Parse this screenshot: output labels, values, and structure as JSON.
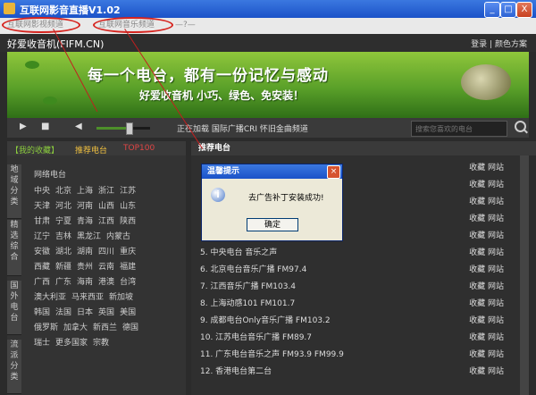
{
  "window": {
    "title": "互联网影音直播V1.02",
    "minimize": "_",
    "maximize": "□",
    "close": "X"
  },
  "tabs": [
    {
      "label": "互联网影视频道"
    },
    {
      "label": "互联网音乐频道"
    },
    {
      "label": "—?—"
    }
  ],
  "app": {
    "logo": "好爱收音机(FIFM.CN)",
    "login": "登录",
    "sep": "|",
    "color_scheme": "颜色方案"
  },
  "banner": {
    "slogan": "每一个电台，都有一份记忆与感动",
    "sub": "好爱收音机 小巧、绿色、免安装！"
  },
  "player": {
    "play": "▶",
    "stop": "■",
    "volume": "◀",
    "volume_level": 0.6,
    "now_playing": "正在加载 国际广播CRI 怀旧金曲频道",
    "search_placeholder": "搜索您喜欢的电台"
  },
  "left": {
    "tabs": [
      "【我的收藏】",
      "推荐电台",
      "TOP100"
    ],
    "categories": [
      {
        "label": "地域分类"
      },
      {
        "label": "精选综合"
      },
      {
        "label": "国外电台"
      },
      {
        "label": "流派分类"
      }
    ],
    "grid_title": "网络电台",
    "rows": [
      [
        "中央",
        "北京",
        "上海",
        "浙江",
        "江苏"
      ],
      [
        "天津",
        "河北",
        "河南",
        "山西",
        "山东"
      ],
      [
        "甘肃",
        "宁夏",
        "青海",
        "江西",
        "陕西"
      ],
      [
        "辽宁",
        "吉林",
        "黑龙江",
        "内蒙古"
      ],
      [
        "安徽",
        "湖北",
        "湖南",
        "四川",
        "重庆"
      ],
      [
        "西藏",
        "新疆",
        "贵州",
        "云南",
        "福建"
      ],
      [
        "广西",
        "广东",
        "海南",
        "港澳",
        "台湾"
      ],
      [
        "澳大利亚",
        "马来西亚",
        "新加坡"
      ],
      [
        "韩国",
        "法国",
        "日本",
        "英国",
        "美国"
      ],
      [
        "俄罗斯",
        "加拿大",
        "新西兰",
        "德国"
      ],
      [
        "瑞士",
        "更多国家",
        "宗教"
      ]
    ]
  },
  "right": {
    "title": "推荐电台",
    "collect": "收藏",
    "website": "网站",
    "stations": [
      "",
      "",
      "",
      "",
      "",
      "5. 中央电台 音乐之声",
      "6. 北京电台音乐广播 FM97.4",
      "7. 江西音乐广播 FM103.4",
      "8. 上海动感101 FM101.7",
      "9. 成都电台Only音乐广播 FM103.2",
      "10. 江苏电台音乐广播 FM89.7",
      "11. 广东电台音乐之声 FM93.9 FM99.9",
      "12. 香港电台第二台"
    ]
  },
  "dialog": {
    "title": "温馨提示",
    "message": "去广告补丁安装成功!",
    "ok": "确定",
    "icon": "i",
    "close": "×"
  },
  "colors": {
    "accent": "#1b52c8",
    "banner": "#5aa029",
    "annotation": "#d6241f"
  }
}
